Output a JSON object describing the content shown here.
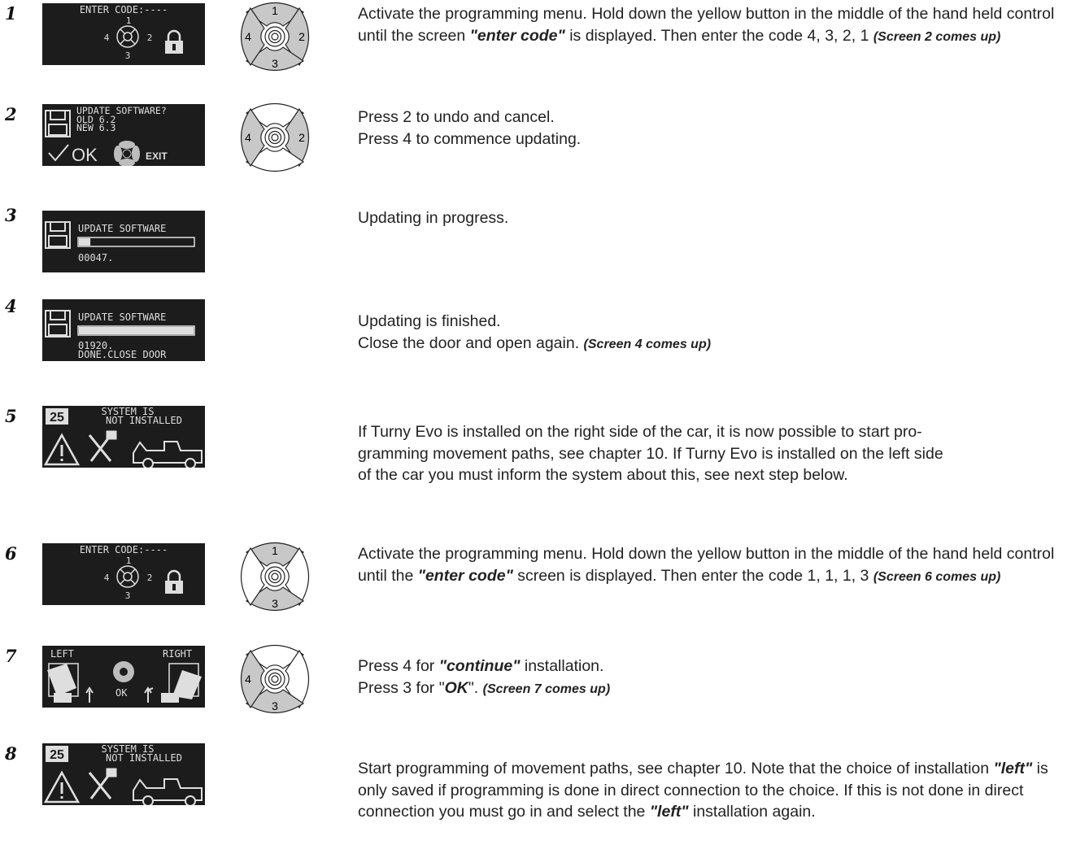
{
  "steps": [
    {
      "num": "1",
      "screen": {
        "type": "code",
        "title": "ENTER CODE:----",
        "labels": [
          "1",
          "4",
          "2",
          "3"
        ]
      },
      "pad": {
        "labels": [
          "1",
          "4",
          "2",
          "3"
        ],
        "active": [
          "1",
          "4",
          "2",
          "3"
        ]
      },
      "text": {
        "a": "Activate the programming menu. Hold down the yellow button in the middle of the hand held control until the screen ",
        "b": "\"enter code\"",
        "c": " is displayed. Then enter the code 4, 3, 2, 1 ",
        "d": "(Screen 2 comes up)"
      }
    },
    {
      "num": "2",
      "screen": {
        "type": "update",
        "line1": "UPDATE SOFTWARE?",
        "line2": "OLD 6.2",
        "line3": "NEW 6.3",
        "ok": "OK",
        "exit": "EXIT"
      },
      "pad": {
        "labels": [
          "4",
          "2"
        ],
        "active": [
          "4",
          "2"
        ]
      },
      "text": {
        "line1": "Press 2 to undo and cancel.",
        "line2": "Press 4 to commence updating."
      }
    },
    {
      "num": "3",
      "screen": {
        "type": "progress",
        "title": "UPDATE SOFTWARE",
        "counter": "00047.",
        "progress": 0.1
      },
      "text": {
        "line1": "Updating in progress."
      }
    },
    {
      "num": "4",
      "screen": {
        "type": "progress",
        "title": "UPDATE SOFTWARE",
        "counter": "01920.",
        "status": "DONE.CLOSE DOOR",
        "progress": 1.0
      },
      "text": {
        "line1": "Updating is finished.",
        "line2": "Close the door and open again. ",
        "note": "(Screen 4 comes up)"
      }
    },
    {
      "num": "5",
      "screen": {
        "type": "system",
        "badge": "25",
        "line1": "SYSTEM IS",
        "line2": "NOT INSTALLED"
      },
      "text": {
        "line1": "If Turny Evo is installed on the right side of the car, it is now possible to start pro-",
        "line2": "gramming movement paths, see chapter 10. If Turny Evo is installed on the left side",
        "line3": "of the car you must inform the system about this, see next step below."
      }
    },
    {
      "num": "6",
      "screen": {
        "type": "code",
        "title": "ENTER CODE:----",
        "labels": [
          "1",
          "4",
          "2",
          "3"
        ]
      },
      "pad": {
        "labels": [
          "1",
          "",
          "",
          "3"
        ],
        "active": [
          "1",
          "3"
        ]
      },
      "text": {
        "a": "Activate the programming menu. Hold down the yellow button in the middle of the hand held control until the ",
        "b": "\"enter code\"",
        "c": " screen is displayed. Then enter the code 1, 1, 1, 3 ",
        "d": "(Screen 6 comes up)"
      }
    },
    {
      "num": "7",
      "screen": {
        "type": "side",
        "left": "LEFT",
        "right": "RIGHT",
        "ok": "OK"
      },
      "pad": {
        "labels": [
          "",
          "4",
          "",
          "3"
        ],
        "active": [
          "4",
          "3"
        ]
      },
      "text": {
        "l1a": "Press 4 for ",
        "l1b": "\"continue\"",
        "l1c": " installation.",
        "l2a": "Press 3 for \"",
        "l2b": "OK",
        "l2c": "\". ",
        "l2d": "(Screen 7 comes up)"
      }
    },
    {
      "num": "8",
      "screen": {
        "type": "system",
        "badge": "25",
        "line1": "SYSTEM IS",
        "line2": "NOT INSTALLED"
      },
      "text": {
        "a": "Start programming of movement paths, see chapter 10. Note that the choice of installation ",
        "b": "\"left\"",
        "c": " is only saved if programming is done in direct connection to the choice. If this is not done in direct connection you must go in and select the ",
        "d": "\"left\"",
        "e": " installation again."
      }
    }
  ]
}
